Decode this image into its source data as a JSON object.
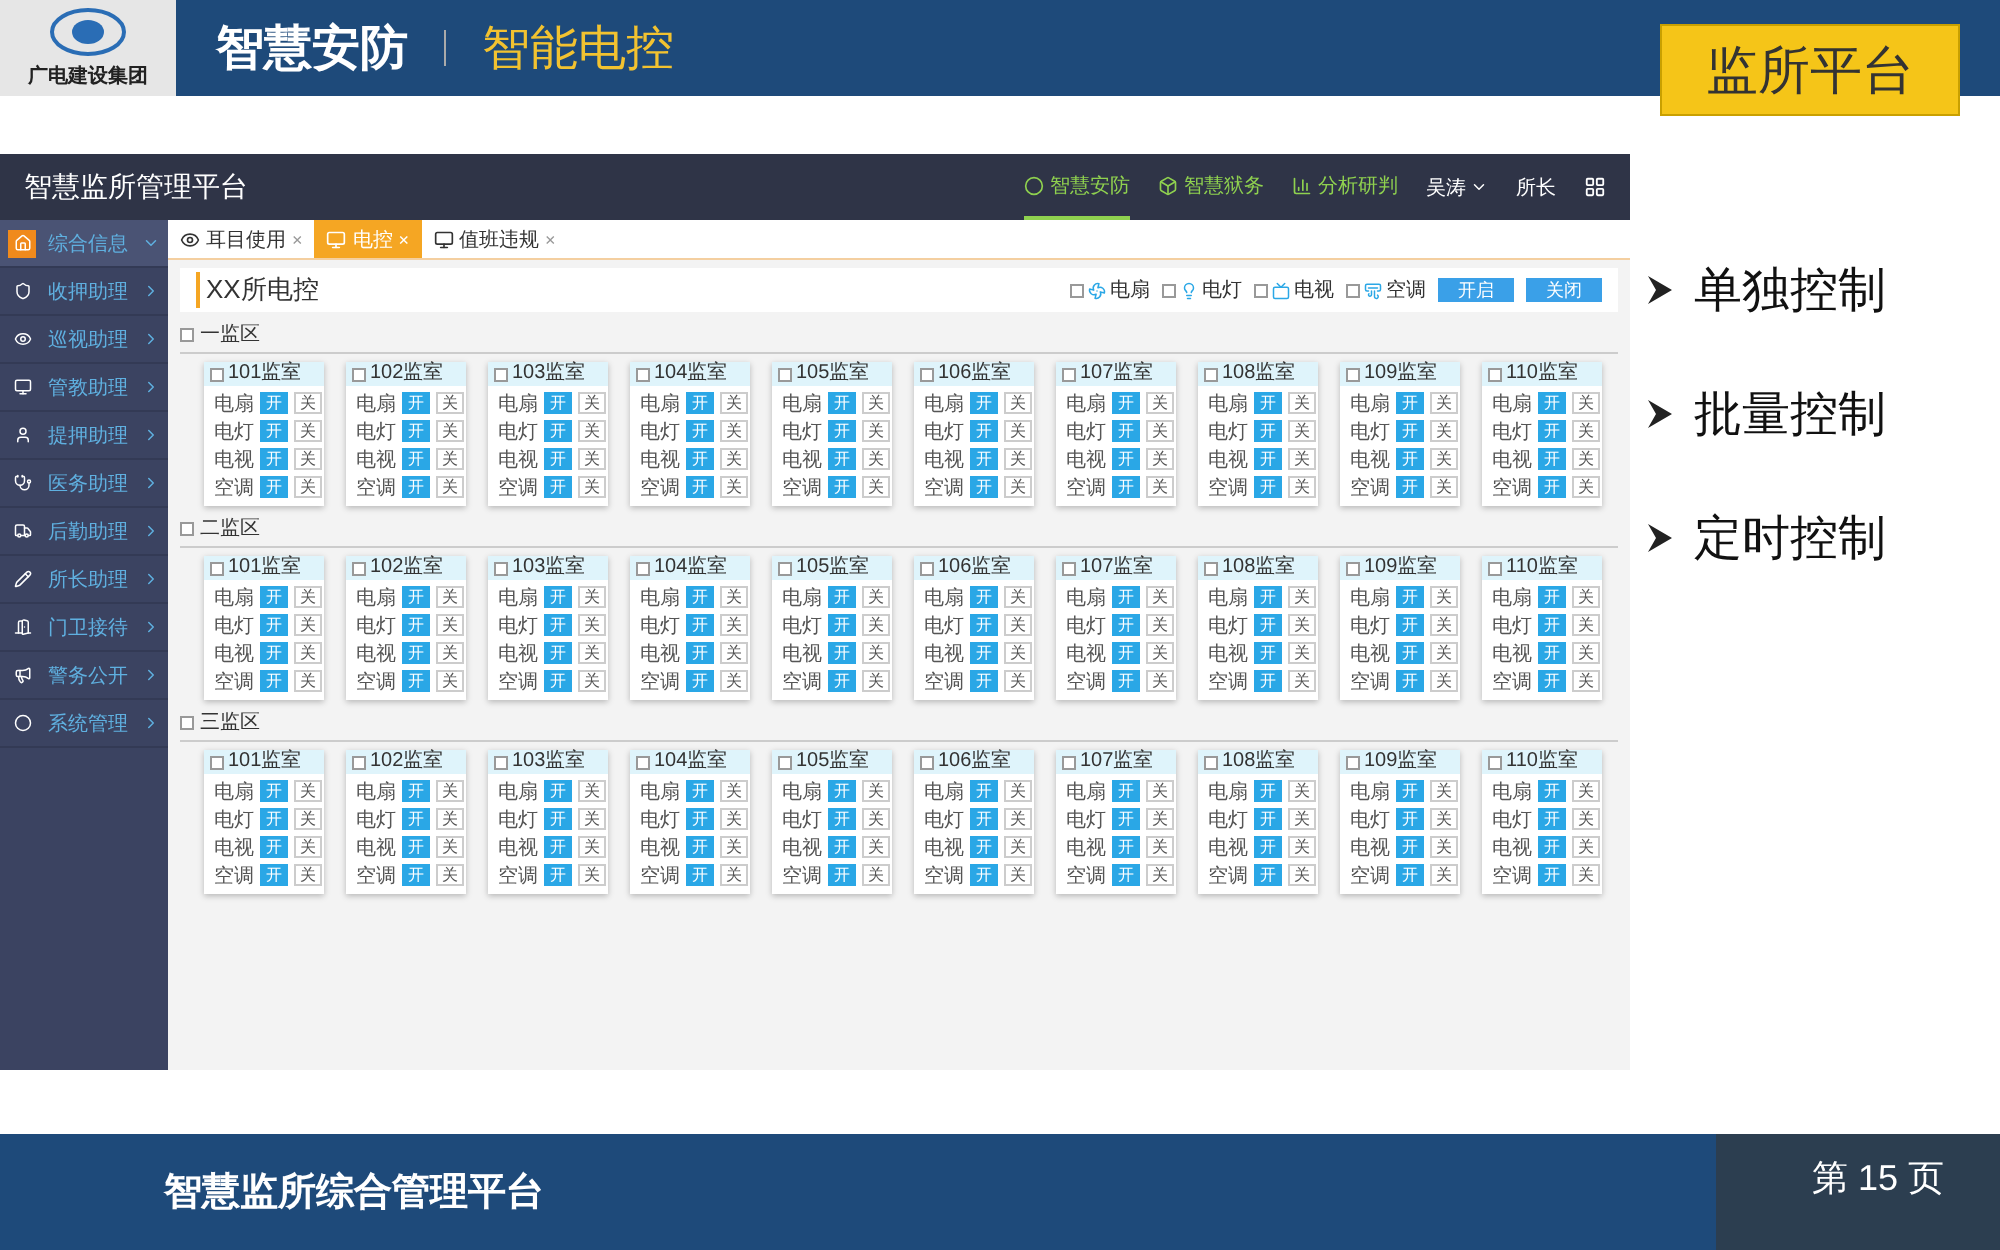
{
  "header": {
    "logo_text": "广电建设集团",
    "title": "智慧安防",
    "subtitle": "智能电控",
    "badge": "监所平台"
  },
  "app": {
    "title": "智慧监所管理平台",
    "nav": [
      {
        "label": "智慧安防",
        "selected": true
      },
      {
        "label": "智慧狱务",
        "selected": false
      },
      {
        "label": "分析研判",
        "selected": false
      }
    ],
    "user": "吴涛",
    "role": "所长",
    "sidebar": [
      {
        "label": "综合信息",
        "selected": true
      },
      {
        "label": "收押助理",
        "selected": false
      },
      {
        "label": "巡视助理",
        "selected": false
      },
      {
        "label": "管教助理",
        "selected": false
      },
      {
        "label": "提押助理",
        "selected": false
      },
      {
        "label": "医务助理",
        "selected": false
      },
      {
        "label": "后勤助理",
        "selected": false
      },
      {
        "label": "所长助理",
        "selected": false
      },
      {
        "label": "门卫接待",
        "selected": false
      },
      {
        "label": "警务公开",
        "selected": false
      },
      {
        "label": "系统管理",
        "selected": false
      }
    ],
    "tabs": [
      {
        "label": "耳目使用",
        "selected": false,
        "close": "×"
      },
      {
        "label": "电控",
        "selected": true,
        "close": "×"
      },
      {
        "label": "值班违规",
        "selected": false,
        "close": "×"
      }
    ],
    "page_title": "XX所电控",
    "filters": [
      {
        "label": "电扇",
        "checked": false
      },
      {
        "label": "电灯",
        "checked": false
      },
      {
        "label": "电视",
        "checked": false
      },
      {
        "label": "空调",
        "checked": false
      }
    ],
    "buttons": [
      "开启",
      "关闭"
    ],
    "zones": [
      {
        "name": "一监区",
        "checked": false,
        "rooms": [
          {
            "name": "101监室",
            "checked": false,
            "devices": [
              {
                "label": "电扇",
                "on": true,
                "toggle": [
                  "开",
                  "关"
                ]
              },
              {
                "label": "电灯",
                "on": true,
                "toggle": [
                  "开",
                  "关"
                ]
              },
              {
                "label": "电视",
                "on": true,
                "toggle": [
                  "开",
                  "关"
                ]
              },
              {
                "label": "空调",
                "on": true,
                "toggle": [
                  "开",
                  "关"
                ]
              }
            ]
          },
          {
            "name": "102监室",
            "checked": false,
            "devices": [
              {
                "label": "电扇",
                "on": true,
                "toggle": [
                  "开",
                  "关"
                ]
              },
              {
                "label": "电灯",
                "on": true,
                "toggle": [
                  "开",
                  "关"
                ]
              },
              {
                "label": "电视",
                "on": true,
                "toggle": [
                  "开",
                  "关"
                ]
              },
              {
                "label": "空调",
                "on": true,
                "toggle": [
                  "开",
                  "关"
                ]
              }
            ]
          },
          {
            "name": "103监室",
            "checked": false,
            "devices": [
              {
                "label": "电扇",
                "on": true,
                "toggle": [
                  "开",
                  "关"
                ]
              },
              {
                "label": "电灯",
                "on": true,
                "toggle": [
                  "开",
                  "关"
                ]
              },
              {
                "label": "电视",
                "on": true,
                "toggle": [
                  "开",
                  "关"
                ]
              },
              {
                "label": "空调",
                "on": true,
                "toggle": [
                  "开",
                  "关"
                ]
              }
            ]
          },
          {
            "name": "104监室",
            "checked": false,
            "devices": [
              {
                "label": "电扇",
                "on": true,
                "toggle": [
                  "开",
                  "关"
                ]
              },
              {
                "label": "电灯",
                "on": true,
                "toggle": [
                  "开",
                  "关"
                ]
              },
              {
                "label": "电视",
                "on": true,
                "toggle": [
                  "开",
                  "关"
                ]
              },
              {
                "label": "空调",
                "on": true,
                "toggle": [
                  "开",
                  "关"
                ]
              }
            ]
          },
          {
            "name": "105监室",
            "checked": false,
            "devices": [
              {
                "label": "电扇",
                "on": true,
                "toggle": [
                  "开",
                  "关"
                ]
              },
              {
                "label": "电灯",
                "on": true,
                "toggle": [
                  "开",
                  "关"
                ]
              },
              {
                "label": "电视",
                "on": true,
                "toggle": [
                  "开",
                  "关"
                ]
              },
              {
                "label": "空调",
                "on": true,
                "toggle": [
                  "开",
                  "关"
                ]
              }
            ]
          },
          {
            "name": "106监室",
            "checked": false,
            "devices": [
              {
                "label": "电扇",
                "on": true,
                "toggle": [
                  "开",
                  "关"
                ]
              },
              {
                "label": "电灯",
                "on": true,
                "toggle": [
                  "开",
                  "关"
                ]
              },
              {
                "label": "电视",
                "on": true,
                "toggle": [
                  "开",
                  "关"
                ]
              },
              {
                "label": "空调",
                "on": true,
                "toggle": [
                  "开",
                  "关"
                ]
              }
            ]
          },
          {
            "name": "107监室",
            "checked": false,
            "devices": [
              {
                "label": "电扇",
                "on": true,
                "toggle": [
                  "开",
                  "关"
                ]
              },
              {
                "label": "电灯",
                "on": true,
                "toggle": [
                  "开",
                  "关"
                ]
              },
              {
                "label": "电视",
                "on": true,
                "toggle": [
                  "开",
                  "关"
                ]
              },
              {
                "label": "空调",
                "on": true,
                "toggle": [
                  "开",
                  "关"
                ]
              }
            ]
          },
          {
            "name": "108监室",
            "checked": false,
            "devices": [
              {
                "label": "电扇",
                "on": true,
                "toggle": [
                  "开",
                  "关"
                ]
              },
              {
                "label": "电灯",
                "on": true,
                "toggle": [
                  "开",
                  "关"
                ]
              },
              {
                "label": "电视",
                "on": true,
                "toggle": [
                  "开",
                  "关"
                ]
              },
              {
                "label": "空调",
                "on": true,
                "toggle": [
                  "开",
                  "关"
                ]
              }
            ]
          },
          {
            "name": "109监室",
            "checked": false,
            "devices": [
              {
                "label": "电扇",
                "on": true,
                "toggle": [
                  "开",
                  "关"
                ]
              },
              {
                "label": "电灯",
                "on": true,
                "toggle": [
                  "开",
                  "关"
                ]
              },
              {
                "label": "电视",
                "on": true,
                "toggle": [
                  "开",
                  "关"
                ]
              },
              {
                "label": "空调",
                "on": true,
                "toggle": [
                  "开",
                  "关"
                ]
              }
            ]
          },
          {
            "name": "110监室",
            "checked": false,
            "devices": [
              {
                "label": "电扇",
                "on": true,
                "toggle": [
                  "开",
                  "关"
                ]
              },
              {
                "label": "电灯",
                "on": true,
                "toggle": [
                  "开",
                  "关"
                ]
              },
              {
                "label": "电视",
                "on": true,
                "toggle": [
                  "开",
                  "关"
                ]
              },
              {
                "label": "空调",
                "on": true,
                "toggle": [
                  "开",
                  "关"
                ]
              }
            ]
          }
        ]
      },
      {
        "name": "二监区",
        "checked": false,
        "rooms": [
          {
            "name": "101监室",
            "checked": false,
            "devices": [
              {
                "label": "电扇",
                "on": true,
                "toggle": [
                  "开",
                  "关"
                ]
              },
              {
                "label": "电灯",
                "on": true,
                "toggle": [
                  "开",
                  "关"
                ]
              },
              {
                "label": "电视",
                "on": true,
                "toggle": [
                  "开",
                  "关"
                ]
              },
              {
                "label": "空调",
                "on": true,
                "toggle": [
                  "开",
                  "关"
                ]
              }
            ]
          },
          {
            "name": "102监室",
            "checked": false,
            "devices": [
              {
                "label": "电扇",
                "on": true,
                "toggle": [
                  "开",
                  "关"
                ]
              },
              {
                "label": "电灯",
                "on": true,
                "toggle": [
                  "开",
                  "关"
                ]
              },
              {
                "label": "电视",
                "on": true,
                "toggle": [
                  "开",
                  "关"
                ]
              },
              {
                "label": "空调",
                "on": true,
                "toggle": [
                  "开",
                  "关"
                ]
              }
            ]
          },
          {
            "name": "103监室",
            "checked": false,
            "devices": [
              {
                "label": "电扇",
                "on": true,
                "toggle": [
                  "开",
                  "关"
                ]
              },
              {
                "label": "电灯",
                "on": true,
                "toggle": [
                  "开",
                  "关"
                ]
              },
              {
                "label": "电视",
                "on": true,
                "toggle": [
                  "开",
                  "关"
                ]
              },
              {
                "label": "空调",
                "on": true,
                "toggle": [
                  "开",
                  "关"
                ]
              }
            ]
          },
          {
            "name": "104监室",
            "checked": false,
            "devices": [
              {
                "label": "电扇",
                "on": true,
                "toggle": [
                  "开",
                  "关"
                ]
              },
              {
                "label": "电灯",
                "on": true,
                "toggle": [
                  "开",
                  "关"
                ]
              },
              {
                "label": "电视",
                "on": true,
                "toggle": [
                  "开",
                  "关"
                ]
              },
              {
                "label": "空调",
                "on": true,
                "toggle": [
                  "开",
                  "关"
                ]
              }
            ]
          },
          {
            "name": "105监室",
            "checked": false,
            "devices": [
              {
                "label": "电扇",
                "on": true,
                "toggle": [
                  "开",
                  "关"
                ]
              },
              {
                "label": "电灯",
                "on": true,
                "toggle": [
                  "开",
                  "关"
                ]
              },
              {
                "label": "电视",
                "on": true,
                "toggle": [
                  "开",
                  "关"
                ]
              },
              {
                "label": "空调",
                "on": true,
                "toggle": [
                  "开",
                  "关"
                ]
              }
            ]
          },
          {
            "name": "106监室",
            "checked": false,
            "devices": [
              {
                "label": "电扇",
                "on": true,
                "toggle": [
                  "开",
                  "关"
                ]
              },
              {
                "label": "电灯",
                "on": true,
                "toggle": [
                  "开",
                  "关"
                ]
              },
              {
                "label": "电视",
                "on": true,
                "toggle": [
                  "开",
                  "关"
                ]
              },
              {
                "label": "空调",
                "on": true,
                "toggle": [
                  "开",
                  "关"
                ]
              }
            ]
          },
          {
            "name": "107监室",
            "checked": false,
            "devices": [
              {
                "label": "电扇",
                "on": true,
                "toggle": [
                  "开",
                  "关"
                ]
              },
              {
                "label": "电灯",
                "on": true,
                "toggle": [
                  "开",
                  "关"
                ]
              },
              {
                "label": "电视",
                "on": true,
                "toggle": [
                  "开",
                  "关"
                ]
              },
              {
                "label": "空调",
                "on": true,
                "toggle": [
                  "开",
                  "关"
                ]
              }
            ]
          },
          {
            "name": "108监室",
            "checked": false,
            "devices": [
              {
                "label": "电扇",
                "on": true,
                "toggle": [
                  "开",
                  "关"
                ]
              },
              {
                "label": "电灯",
                "on": true,
                "toggle": [
                  "开",
                  "关"
                ]
              },
              {
                "label": "电视",
                "on": true,
                "toggle": [
                  "开",
                  "关"
                ]
              },
              {
                "label": "空调",
                "on": true,
                "toggle": [
                  "开",
                  "关"
                ]
              }
            ]
          },
          {
            "name": "109监室",
            "checked": false,
            "devices": [
              {
                "label": "电扇",
                "on": true,
                "toggle": [
                  "开",
                  "关"
                ]
              },
              {
                "label": "电灯",
                "on": true,
                "toggle": [
                  "开",
                  "关"
                ]
              },
              {
                "label": "电视",
                "on": true,
                "toggle": [
                  "开",
                  "关"
                ]
              },
              {
                "label": "空调",
                "on": true,
                "toggle": [
                  "开",
                  "关"
                ]
              }
            ]
          },
          {
            "name": "110监室",
            "checked": false,
            "devices": [
              {
                "label": "电扇",
                "on": true,
                "toggle": [
                  "开",
                  "关"
                ]
              },
              {
                "label": "电灯",
                "on": true,
                "toggle": [
                  "开",
                  "关"
                ]
              },
              {
                "label": "电视",
                "on": true,
                "toggle": [
                  "开",
                  "关"
                ]
              },
              {
                "label": "空调",
                "on": true,
                "toggle": [
                  "开",
                  "关"
                ]
              }
            ]
          }
        ]
      },
      {
        "name": "三监区",
        "checked": false,
        "rooms": [
          {
            "name": "101监室",
            "checked": false,
            "devices": [
              {
                "label": "电扇",
                "on": true,
                "toggle": [
                  "开",
                  "关"
                ]
              },
              {
                "label": "电灯",
                "on": true,
                "toggle": [
                  "开",
                  "关"
                ]
              },
              {
                "label": "电视",
                "on": true,
                "toggle": [
                  "开",
                  "关"
                ]
              },
              {
                "label": "空调",
                "on": true,
                "toggle": [
                  "开",
                  "关"
                ]
              }
            ]
          },
          {
            "name": "102监室",
            "checked": false,
            "devices": [
              {
                "label": "电扇",
                "on": true,
                "toggle": [
                  "开",
                  "关"
                ]
              },
              {
                "label": "电灯",
                "on": true,
                "toggle": [
                  "开",
                  "关"
                ]
              },
              {
                "label": "电视",
                "on": true,
                "toggle": [
                  "开",
                  "关"
                ]
              },
              {
                "label": "空调",
                "on": true,
                "toggle": [
                  "开",
                  "关"
                ]
              }
            ]
          },
          {
            "name": "103监室",
            "checked": false,
            "devices": [
              {
                "label": "电扇",
                "on": true,
                "toggle": [
                  "开",
                  "关"
                ]
              },
              {
                "label": "电灯",
                "on": true,
                "toggle": [
                  "开",
                  "关"
                ]
              },
              {
                "label": "电视",
                "on": true,
                "toggle": [
                  "开",
                  "关"
                ]
              },
              {
                "label": "空调",
                "on": true,
                "toggle": [
                  "开",
                  "关"
                ]
              }
            ]
          },
          {
            "name": "104监室",
            "checked": false,
            "devices": [
              {
                "label": "电扇",
                "on": true,
                "toggle": [
                  "开",
                  "关"
                ]
              },
              {
                "label": "电灯",
                "on": true,
                "toggle": [
                  "开",
                  "关"
                ]
              },
              {
                "label": "电视",
                "on": true,
                "toggle": [
                  "开",
                  "关"
                ]
              },
              {
                "label": "空调",
                "on": true,
                "toggle": [
                  "开",
                  "关"
                ]
              }
            ]
          },
          {
            "name": "105监室",
            "checked": false,
            "devices": [
              {
                "label": "电扇",
                "on": true,
                "toggle": [
                  "开",
                  "关"
                ]
              },
              {
                "label": "电灯",
                "on": true,
                "toggle": [
                  "开",
                  "关"
                ]
              },
              {
                "label": "电视",
                "on": true,
                "toggle": [
                  "开",
                  "关"
                ]
              },
              {
                "label": "空调",
                "on": true,
                "toggle": [
                  "开",
                  "关"
                ]
              }
            ]
          },
          {
            "name": "106监室",
            "checked": false,
            "devices": [
              {
                "label": "电扇",
                "on": true,
                "toggle": [
                  "开",
                  "关"
                ]
              },
              {
                "label": "电灯",
                "on": true,
                "toggle": [
                  "开",
                  "关"
                ]
              },
              {
                "label": "电视",
                "on": true,
                "toggle": [
                  "开",
                  "关"
                ]
              },
              {
                "label": "空调",
                "on": true,
                "toggle": [
                  "开",
                  "关"
                ]
              }
            ]
          },
          {
            "name": "107监室",
            "checked": false,
            "devices": [
              {
                "label": "电扇",
                "on": true,
                "toggle": [
                  "开",
                  "关"
                ]
              },
              {
                "label": "电灯",
                "on": true,
                "toggle": [
                  "开",
                  "关"
                ]
              },
              {
                "label": "电视",
                "on": true,
                "toggle": [
                  "开",
                  "关"
                ]
              },
              {
                "label": "空调",
                "on": true,
                "toggle": [
                  "开",
                  "关"
                ]
              }
            ]
          },
          {
            "name": "108监室",
            "checked": false,
            "devices": [
              {
                "label": "电扇",
                "on": true,
                "toggle": [
                  "开",
                  "关"
                ]
              },
              {
                "label": "电灯",
                "on": true,
                "toggle": [
                  "开",
                  "关"
                ]
              },
              {
                "label": "电视",
                "on": true,
                "toggle": [
                  "开",
                  "关"
                ]
              },
              {
                "label": "空调",
                "on": true,
                "toggle": [
                  "开",
                  "关"
                ]
              }
            ]
          },
          {
            "name": "109监室",
            "checked": false,
            "devices": [
              {
                "label": "电扇",
                "on": true,
                "toggle": [
                  "开",
                  "关"
                ]
              },
              {
                "label": "电灯",
                "on": true,
                "toggle": [
                  "开",
                  "关"
                ]
              },
              {
                "label": "电视",
                "on": true,
                "toggle": [
                  "开",
                  "关"
                ]
              },
              {
                "label": "空调",
                "on": true,
                "toggle": [
                  "开",
                  "关"
                ]
              }
            ]
          },
          {
            "name": "110监室",
            "checked": false,
            "devices": [
              {
                "label": "电扇",
                "on": true,
                "toggle": [
                  "开",
                  "关"
                ]
              },
              {
                "label": "电灯",
                "on": true,
                "toggle": [
                  "开",
                  "关"
                ]
              },
              {
                "label": "电视",
                "on": true,
                "toggle": [
                  "开",
                  "关"
                ]
              },
              {
                "label": "空调",
                "on": true,
                "toggle": [
                  "开",
                  "关"
                ]
              }
            ]
          }
        ]
      }
    ]
  },
  "bullets": [
    "单独控制",
    "批量控制",
    "定时控制"
  ],
  "footer": {
    "title": "智慧监所综合管理平台",
    "page": "第 15 页"
  }
}
